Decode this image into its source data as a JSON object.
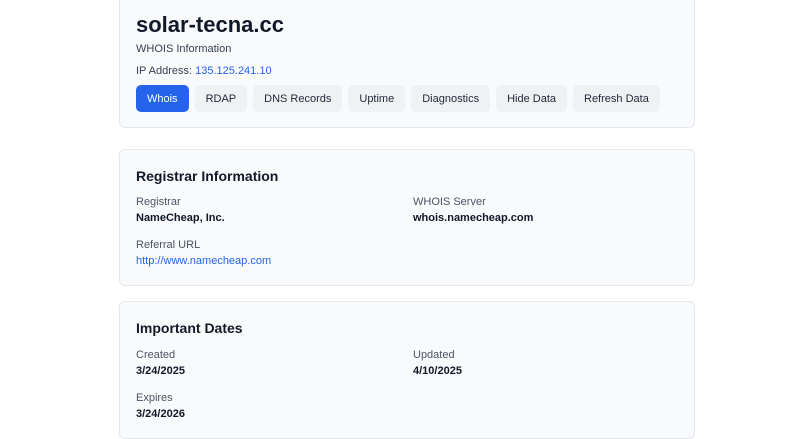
{
  "header": {
    "domain": "solar-tecna.cc",
    "subtitle": "WHOIS Information",
    "ip_label": "IP Address:",
    "ip_value": "135.125.241.10"
  },
  "tabs": [
    {
      "label": "Whois",
      "active": true
    },
    {
      "label": "RDAP",
      "active": false
    },
    {
      "label": "DNS Records",
      "active": false
    },
    {
      "label": "Uptime",
      "active": false
    },
    {
      "label": "Diagnostics",
      "active": false
    },
    {
      "label": "Hide Data",
      "active": false
    },
    {
      "label": "Refresh Data",
      "active": false
    }
  ],
  "registrar": {
    "title": "Registrar Information",
    "registrar_label": "Registrar",
    "registrar_value": "NameCheap, Inc.",
    "whois_server_label": "WHOIS Server",
    "whois_server_value": "whois.namecheap.com",
    "referral_label": "Referral URL",
    "referral_value": "http://www.namecheap.com"
  },
  "dates": {
    "title": "Important Dates",
    "created_label": "Created",
    "created_value": "3/24/2025",
    "updated_label": "Updated",
    "updated_value": "4/10/2025",
    "expires_label": "Expires",
    "expires_value": "3/24/2026"
  },
  "colors": {
    "accent": "#2563eb",
    "card_bg": "#f9fafb",
    "border": "#e5e7eb"
  }
}
